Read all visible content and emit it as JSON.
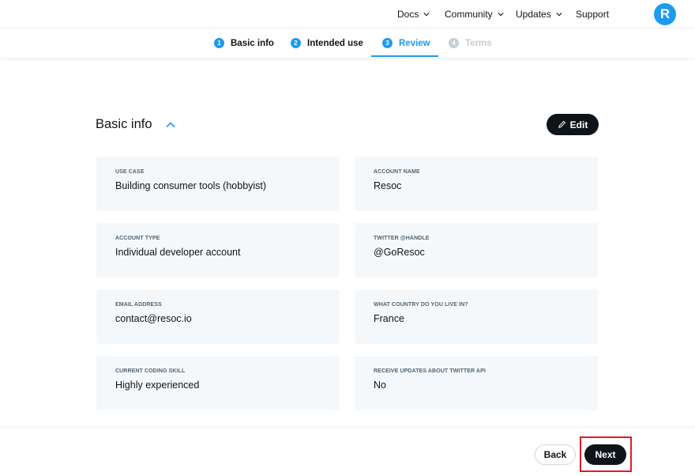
{
  "nav": {
    "items": [
      {
        "label": "Docs",
        "has_dropdown": true
      },
      {
        "label": "Community",
        "has_dropdown": true
      },
      {
        "label": "Updates",
        "has_dropdown": true
      },
      {
        "label": "Support",
        "has_dropdown": false
      }
    ],
    "avatar_letter": "R"
  },
  "stepper": {
    "steps": [
      {
        "num": "1",
        "label": "Basic info",
        "state": "done"
      },
      {
        "num": "2",
        "label": "Intended use",
        "state": "done"
      },
      {
        "num": "3",
        "label": "Review",
        "state": "active"
      },
      {
        "num": "4",
        "label": "Terms",
        "state": "disabled"
      }
    ]
  },
  "section": {
    "title": "Basic info",
    "edit_label": "Edit"
  },
  "fields": [
    {
      "label": "USE CASE",
      "value": "Building consumer tools (hobbyist)"
    },
    {
      "label": "ACCOUNT NAME",
      "value": "Resoc"
    },
    {
      "label": "ACCOUNT TYPE",
      "value": "Individual developer account"
    },
    {
      "label": "TWITTER @HANDLE",
      "value": "@GoResoc"
    },
    {
      "label": "EMAIL ADDRESS",
      "value": "contact@resoc.io"
    },
    {
      "label": "WHAT COUNTRY DO YOU LIVE IN?",
      "value": "France"
    },
    {
      "label": "CURRENT CODING SKILL",
      "value": "Highly experienced"
    },
    {
      "label": "RECEIVE UPDATES ABOUT TWITTER API",
      "value": "No"
    }
  ],
  "footer": {
    "back_label": "Back",
    "next_label": "Next"
  },
  "colors": {
    "accent": "#1d9bf0",
    "dark": "#0f1419",
    "highlight": "#e01b24"
  }
}
